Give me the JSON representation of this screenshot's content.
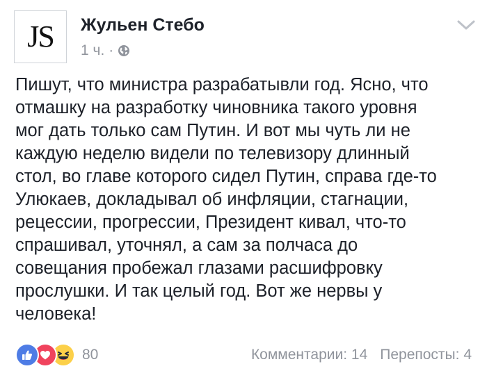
{
  "post": {
    "avatar_text": "JS",
    "author": "Жульен Стебо",
    "time": "1 ч.",
    "separator": "·",
    "privacy_icon": "globe-icon",
    "menu_icon": "chevron-down-icon",
    "body_lines": [
      "Пишут, что министра разрабатывли год. Ясно, что",
      "отмашку на разработку чиновника такого уровня",
      "мог дать только сам Путин. И вот мы чуть ли не",
      "каждую неделю видели по телевизору длинный",
      "стол, во главе которого сидел Путин, справа где-то",
      "Улюкаев, докладывал об инфляции, стагнации,",
      "рецессии, прогрессии, Президент кивал, что-то",
      "спрашивал, уточнял, а сам за полчаса до",
      "совещания пробежал глазами расшифровку",
      "прослушки. И так целый год. Вот же нервы у",
      "человека!"
    ]
  },
  "footer": {
    "reactions": [
      "like-icon",
      "love-icon",
      "haha-icon"
    ],
    "reaction_count": "80",
    "comments": "Комментарии: 14",
    "shares": "Перепосты: 4"
  },
  "colors": {
    "text": "#1d2129",
    "muted": "#90949c",
    "like": "#4e7ce5",
    "love": "#f0435d",
    "haha": "#fcd049"
  }
}
